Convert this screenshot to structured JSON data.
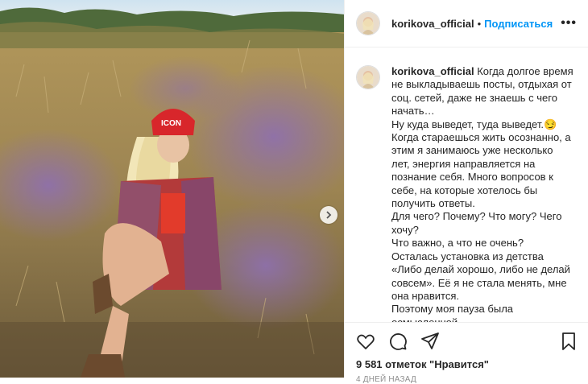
{
  "post": {
    "username": "korikova_official",
    "follow_label": "Подписаться",
    "dot": "•",
    "more_label": "•••",
    "caption_lines": [
      "Когда долгое время",
      "не выкладываешь посты, отдыхая от",
      "соц. сетей, даже не знаешь с чего",
      "начать…",
      "Ну куда выведет, туда выведет.😏",
      "Когда стараешься жить осознанно, а",
      "этим я занимаюсь уже несколько",
      "лет, энергия направляется на",
      "познание себя. Много вопросов к",
      "себе, на которые хотелось бы",
      "получить ответы.",
      "Для чего? Почему? Что могу? Чего",
      "хочу?",
      "Что важно, а что не очень?",
      "Осталась установка из детства",
      "«Либо делай хорошо, либо не делай",
      "совсем». Её я не стала менять, мне",
      "она нравится.",
      "Поэтому моя пауза была",
      "осмысленной."
    ],
    "likes_text": "9 581 отметок \"Нравится\"",
    "date_text": "4 дней назад"
  },
  "icons": {
    "like": "heart-icon",
    "comment": "comment-icon",
    "share": "share-icon",
    "save": "bookmark-icon",
    "next": "chevron-right-icon"
  },
  "colors": {
    "accent": "#0095f6",
    "cap_red": "#d8262b",
    "text": "#262626",
    "muted": "#8e8e8e"
  }
}
